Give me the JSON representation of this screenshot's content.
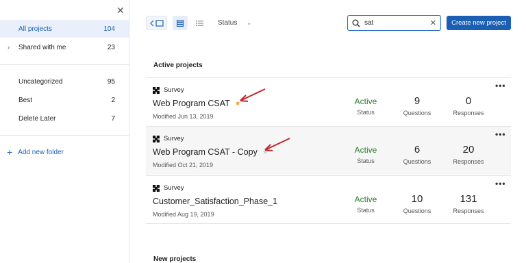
{
  "sidebar": {
    "close_icon": "close-icon",
    "items": [
      {
        "label": "All projects",
        "count": "104",
        "active": true
      },
      {
        "label": "Shared with me",
        "count": "23",
        "chevron": true
      },
      {
        "label": "Uncategorized",
        "count": "95"
      },
      {
        "label": "Best",
        "count": "2"
      },
      {
        "label": "Delete Later",
        "count": "7"
      }
    ],
    "add_folder_label": "Add new folder"
  },
  "toolbar": {
    "status_label": "Status",
    "search_value": "sat",
    "create_label": "Create new project"
  },
  "sections": {
    "active_title": "Active projects",
    "new_title": "New projects"
  },
  "projects": [
    {
      "type": "Survey",
      "name": "Web Program CSAT",
      "starred": true,
      "modified": "Modified Jun 13, 2019",
      "status": "Active",
      "status_label": "Status",
      "questions": "9",
      "questions_label": "Questions",
      "responses": "0",
      "responses_label": "Responses"
    },
    {
      "type": "Survey",
      "name": "Web Program CSAT - Copy",
      "starred": false,
      "modified": "Modified Oct 21, 2019",
      "status": "Active",
      "status_label": "Status",
      "questions": "6",
      "questions_label": "Questions",
      "responses": "20",
      "responses_label": "Responses"
    },
    {
      "type": "Survey",
      "name": "Customer_Satisfaction_Phase_1",
      "starred": false,
      "modified": "Modified Aug 19, 2019",
      "status": "Active",
      "status_label": "Status",
      "questions": "10",
      "questions_label": "Questions",
      "responses": "131",
      "responses_label": "Responses"
    }
  ],
  "colors": {
    "accent": "#1a5fb4",
    "active_green": "#2e7d32",
    "star": "#e8a13a",
    "annotation_red": "#c0272d"
  }
}
